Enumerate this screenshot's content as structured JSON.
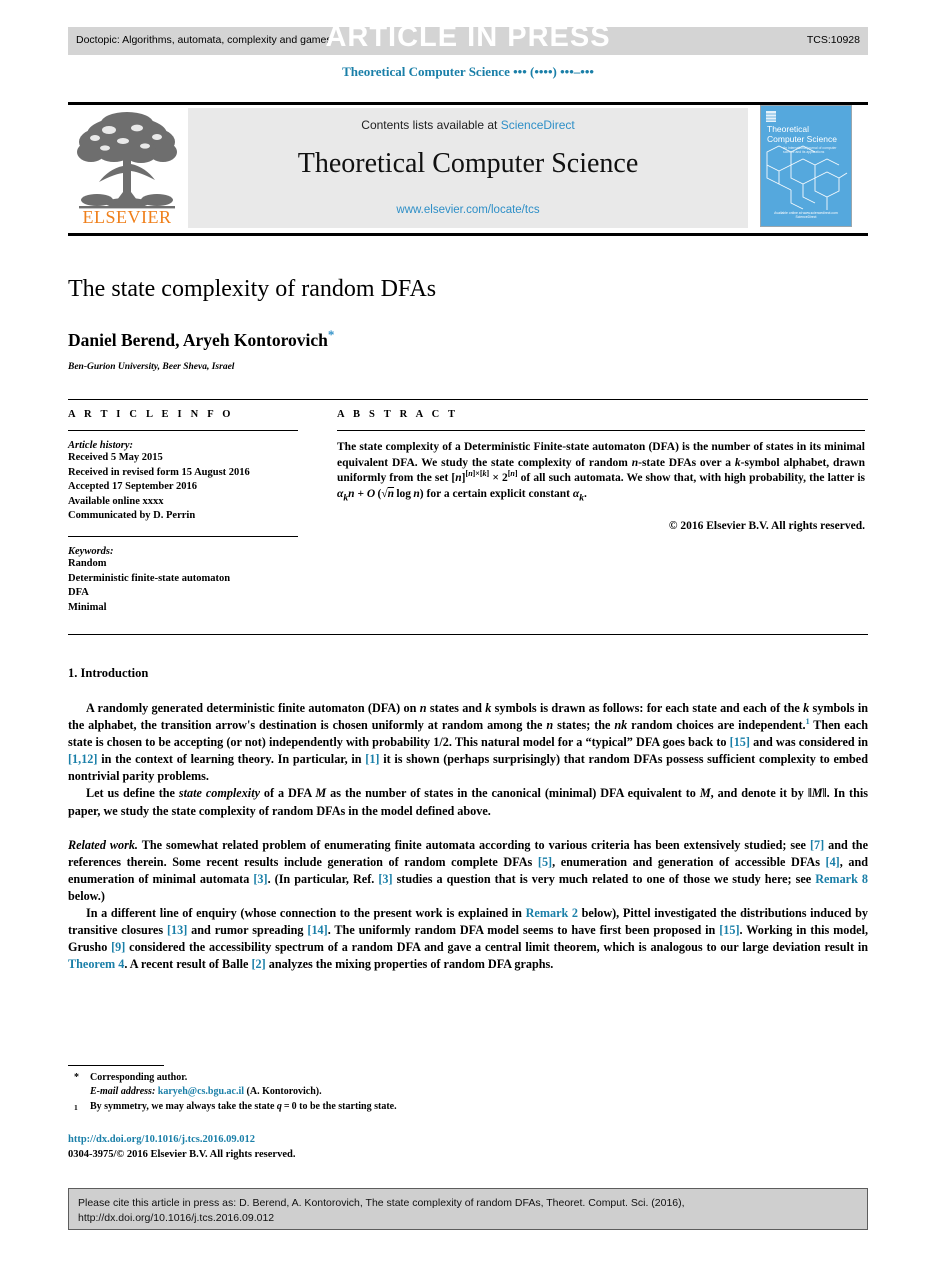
{
  "banner": {
    "doctopic": "Doctopic: Algorithms, automata, complexity and games",
    "stamp": "ARTICLE IN PRESS",
    "code": "TCS:10928"
  },
  "running_head": "Theoretical Computer Science ••• (••••) •••–•••",
  "masthead": {
    "publisher_word": "ELSEVIER",
    "contents_prefix": "Contents lists available at ",
    "contents_link": "ScienceDirect",
    "journal_name": "Theoretical Computer Science",
    "journal_url": "www.elsevier.com/locate/tcs",
    "cover_title_line1": "Theoretical",
    "cover_title_line2": "Computer Science",
    "cover_subtitle": "An international journal of computer science and its applications",
    "cover_footer": "Available online at www.sciencedirect.com",
    "cover_footer2": "ScienceDirect"
  },
  "article": {
    "title": "The state complexity of random DFAs",
    "authors": "Daniel Berend, Aryeh Kontorovich",
    "corresponding_mark": "*",
    "affiliation": "Ben-Gurion University, Beer Sheva, Israel"
  },
  "info": {
    "heading": "A R T I C L E   I N F O",
    "history_label": "Article history:",
    "history": [
      "Received 5 May 2015",
      "Received in revised form 15 August 2016",
      "Accepted 17 September 2016",
      "Available online xxxx",
      "Communicated by D. Perrin"
    ],
    "keywords_label": "Keywords:",
    "keywords": [
      "Random",
      "Deterministic finite-state automaton",
      "DFA",
      "Minimal"
    ]
  },
  "abstract": {
    "heading": "A B S T R A C T",
    "text": "The state complexity of a Deterministic Finite-state automaton (DFA) is the number of states in its minimal equivalent DFA. We study the state complexity of random n-state DFAs over a k-symbol alphabet, drawn uniformly from the set [n][n]×[k] × 2[n] of all such automata. We show that, with high probability, the latter is αkn + O(√n log n) for a certain explicit constant αk.",
    "copyright": "© 2016 Elsevier B.V. All rights reserved."
  },
  "section": {
    "number_title": "1. Introduction",
    "paragraphs": [
      "A randomly generated deterministic finite automaton (DFA) on n states and k symbols is drawn as follows: for each state and each of the k symbols in the alphabet, the transition arrow's destination is chosen uniformly at random among the n states; the nk random choices are independent.1 Then each state is chosen to be accepting (or not) independently with probability 1/2. This natural model for a \"typical\" DFA goes back to [15] and was considered in [1,12] in the context of learning theory. In particular, in [1] it is shown (perhaps surprisingly) that random DFAs possess sufficient complexity to embed nontrivial parity problems.",
      "Let us define the state complexity of a DFA M as the number of states in the canonical (minimal) DFA equivalent to M, and denote it by ‖M‖. In this paper, we study the state complexity of random DFAs in the model defined above.",
      "Related work. The somewhat related problem of enumerating finite automata according to various criteria has been extensively studied; see [7] and the references therein. Some recent results include generation of random complete DFAs [5], enumeration and generation of accessible DFAs [4], and enumeration of minimal automata [3]. (In particular, Ref. [3] studies a question that is very much related to one of those we study here; see Remark 8 below.)",
      "In a different line of enquiry (whose connection to the present work is explained in Remark 2 below), Pittel investigated the distributions induced by transitive closures [13] and rumor spreading [14]. The uniformly random DFA model seems to have first been proposed in [15]. Working in this model, Grusho [9] considered the accessibility spectrum of a random DFA and gave a central limit theorem, which is analogous to our large deviation result in Theorem 4. A recent result of Balle [2] analyzes the mixing properties of random DFA graphs."
    ]
  },
  "footnotes": {
    "corresponding": "Corresponding author.",
    "email_label": "E-mail address:",
    "email": "karyeh@cs.bgu.ac.il",
    "email_suffix": "(A. Kontorovich).",
    "note1": "By symmetry, we may always take the state q = 0 to be the starting state."
  },
  "footer": {
    "doi": "http://dx.doi.org/10.1016/j.tcs.2016.09.012",
    "issn": "0304-3975/© 2016 Elsevier B.V. All rights reserved."
  },
  "cite_box": {
    "line1": "Please cite this article in press as: D. Berend, A. Kontorovich, The state complexity of random DFAs, Theoret. Comput. Sci. (2016),",
    "line2": "http://dx.doi.org/10.1016/j.tcs.2016.09.012"
  },
  "colors": {
    "link": "#1a7fa8",
    "sciencedirect": "#2e8fc7",
    "elsevier_orange": "#ef7f1a",
    "banner_gray": "#d4d4d4",
    "cite_gray": "#cfcfcf"
  }
}
